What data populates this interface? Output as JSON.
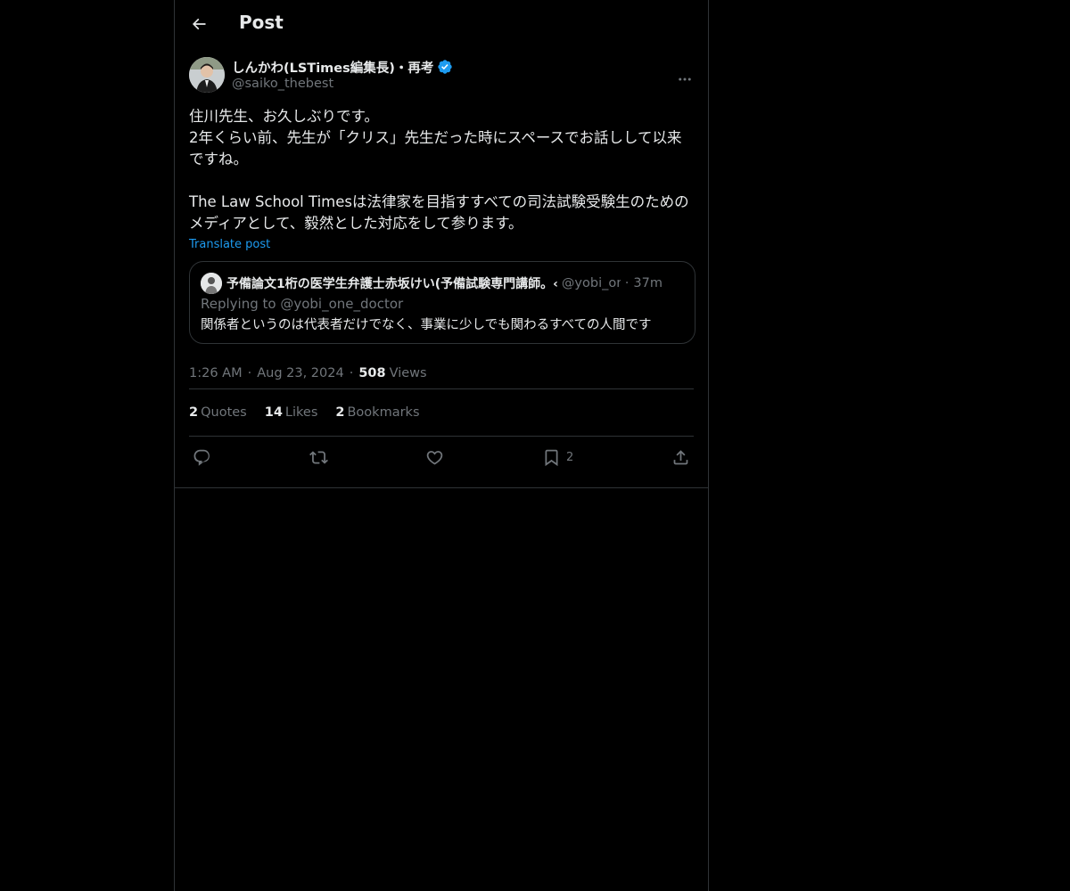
{
  "header": {
    "title": "Post"
  },
  "author": {
    "display_name": "しんかわ(LSTimes編集長)・再考",
    "handle": "@saiko_thebest",
    "verified_badge_color": "#1d9bf0"
  },
  "post": {
    "text": "住川先生、お久しぶりです。\n2年くらい前、先生が「クリス」先生だった時にスペースでお話しして以来ですね。\n\nThe Law School Timesは法律家を目指すすべての司法試験受験生のためのメディアとして、毅然とした対応をして参ります。",
    "translate_label": "Translate post",
    "time": "1:26 AM",
    "date": "Aug 23, 2024",
    "views_count": "508",
    "views_label": "Views"
  },
  "quote": {
    "display_name": "予備論文1桁の医学生弁護士赤坂けい(予備試験専門講師。‹",
    "handle": "@yobi_one_doctor",
    "time": "37m",
    "replying_prefix": "Replying to ",
    "replying_handle": "@yobi_one_doctor",
    "text": "関係者というのは代表者だけでなく、事業に少しでも関わるすべての人間です"
  },
  "stats": {
    "quotes_count": "2",
    "quotes_label": "Quotes",
    "likes_count": "14",
    "likes_label": "Likes",
    "bookmarks_count": "2",
    "bookmarks_label": "Bookmarks"
  },
  "actions": {
    "bookmark_count": "2"
  },
  "separator": "·"
}
